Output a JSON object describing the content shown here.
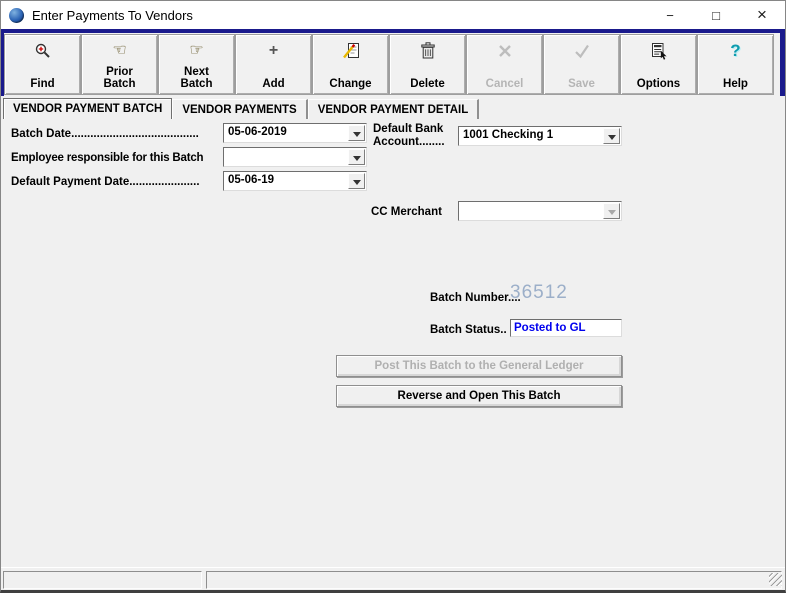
{
  "window": {
    "title": "Enter Payments To Vendors",
    "controls": {
      "minimize": "−",
      "maximize": "□",
      "close": "×"
    }
  },
  "toolbar": {
    "buttons": [
      {
        "id": "find",
        "line1": "Find",
        "line2": "",
        "enabled": true
      },
      {
        "id": "prior-batch",
        "line1": "Prior",
        "line2": "Batch",
        "enabled": true
      },
      {
        "id": "next-batch",
        "line1": "Next",
        "line2": "Batch",
        "enabled": true
      },
      {
        "id": "add",
        "line1": "Add",
        "line2": "",
        "enabled": true
      },
      {
        "id": "change",
        "line1": "Change",
        "line2": "",
        "enabled": true
      },
      {
        "id": "delete",
        "line1": "Delete",
        "line2": "",
        "enabled": true
      },
      {
        "id": "cancel",
        "line1": "Cancel",
        "line2": "",
        "enabled": false
      },
      {
        "id": "save",
        "line1": "Save",
        "line2": "",
        "enabled": false
      },
      {
        "id": "options",
        "line1": "Options",
        "line2": "",
        "enabled": true
      },
      {
        "id": "help",
        "line1": "Help",
        "line2": "",
        "enabled": true
      }
    ]
  },
  "icons": {
    "prior_batch": "☜",
    "next_batch": "☞",
    "add": "+",
    "help": "?"
  },
  "tabs": [
    {
      "label": "VENDOR PAYMENT BATCH",
      "active": true
    },
    {
      "label": "VENDOR PAYMENTS",
      "active": false
    },
    {
      "label": "VENDOR PAYMENT DETAIL",
      "active": false
    }
  ],
  "form": {
    "batch_date": {
      "label": "Batch Date........................................",
      "value": "05-06-2019"
    },
    "employee": {
      "label": "Employee responsible for this Batch",
      "value": ""
    },
    "default_payment_date": {
      "label": "Default Payment Date......................",
      "value": "05-06-19"
    },
    "default_bank_account": {
      "label": "Default Bank Account........",
      "value": "1001 Checking 1"
    },
    "cc_merchant": {
      "label": "CC Merchant",
      "value": "",
      "enabled": false
    },
    "batch_number": {
      "label": "Batch Number....",
      "value": "36512"
    },
    "batch_status": {
      "label": "Batch Status..",
      "value": "Posted to GL"
    }
  },
  "actions": {
    "post": {
      "label": "Post This Batch to the General Ledger",
      "enabled": false
    },
    "reverse": {
      "label": "Reverse and Open This Batch",
      "enabled": true
    }
  },
  "status_bar": {
    "left": "",
    "right": ""
  },
  "colors": {
    "navy_border": "#1A1A8C",
    "batch_number_text": "#9CAFC9",
    "batch_status_text": "#0000EE",
    "help_icon": "#0E9BAE"
  }
}
